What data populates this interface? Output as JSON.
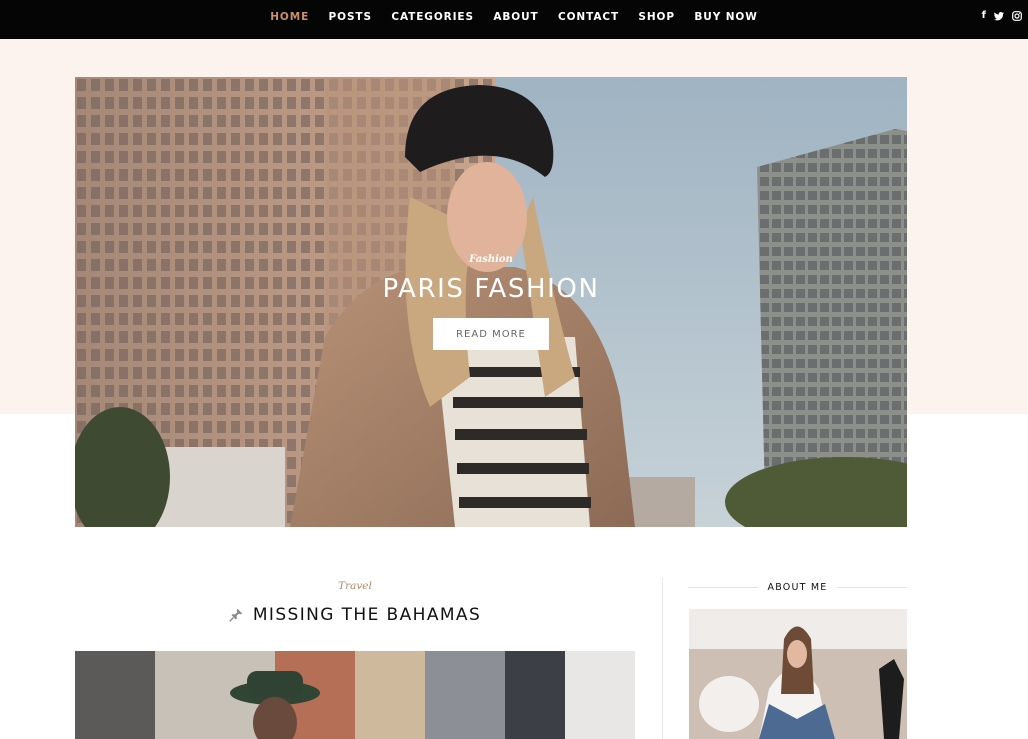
{
  "nav": {
    "items": [
      {
        "label": "HOME",
        "active": true
      },
      {
        "label": "POSTS"
      },
      {
        "label": "CATEGORIES"
      },
      {
        "label": "ABOUT"
      },
      {
        "label": "CONTACT"
      },
      {
        "label": "SHOP"
      },
      {
        "label": "BUY NOW"
      }
    ],
    "social": [
      "facebook-icon",
      "twitter-icon",
      "instagram-icon"
    ],
    "active_color": "#c9906a"
  },
  "hero": {
    "category": "Fashion",
    "title": "PARIS FASHION",
    "button": "READ MORE"
  },
  "post": {
    "category": "Travel",
    "title": "MISSING THE BAHAMAS",
    "pin_icon": "pin-icon"
  },
  "sidebar": {
    "heading": "ABOUT ME"
  },
  "colors": {
    "topbar": "#050505",
    "band": "#fcf3ee",
    "accent": "#b4876a"
  }
}
